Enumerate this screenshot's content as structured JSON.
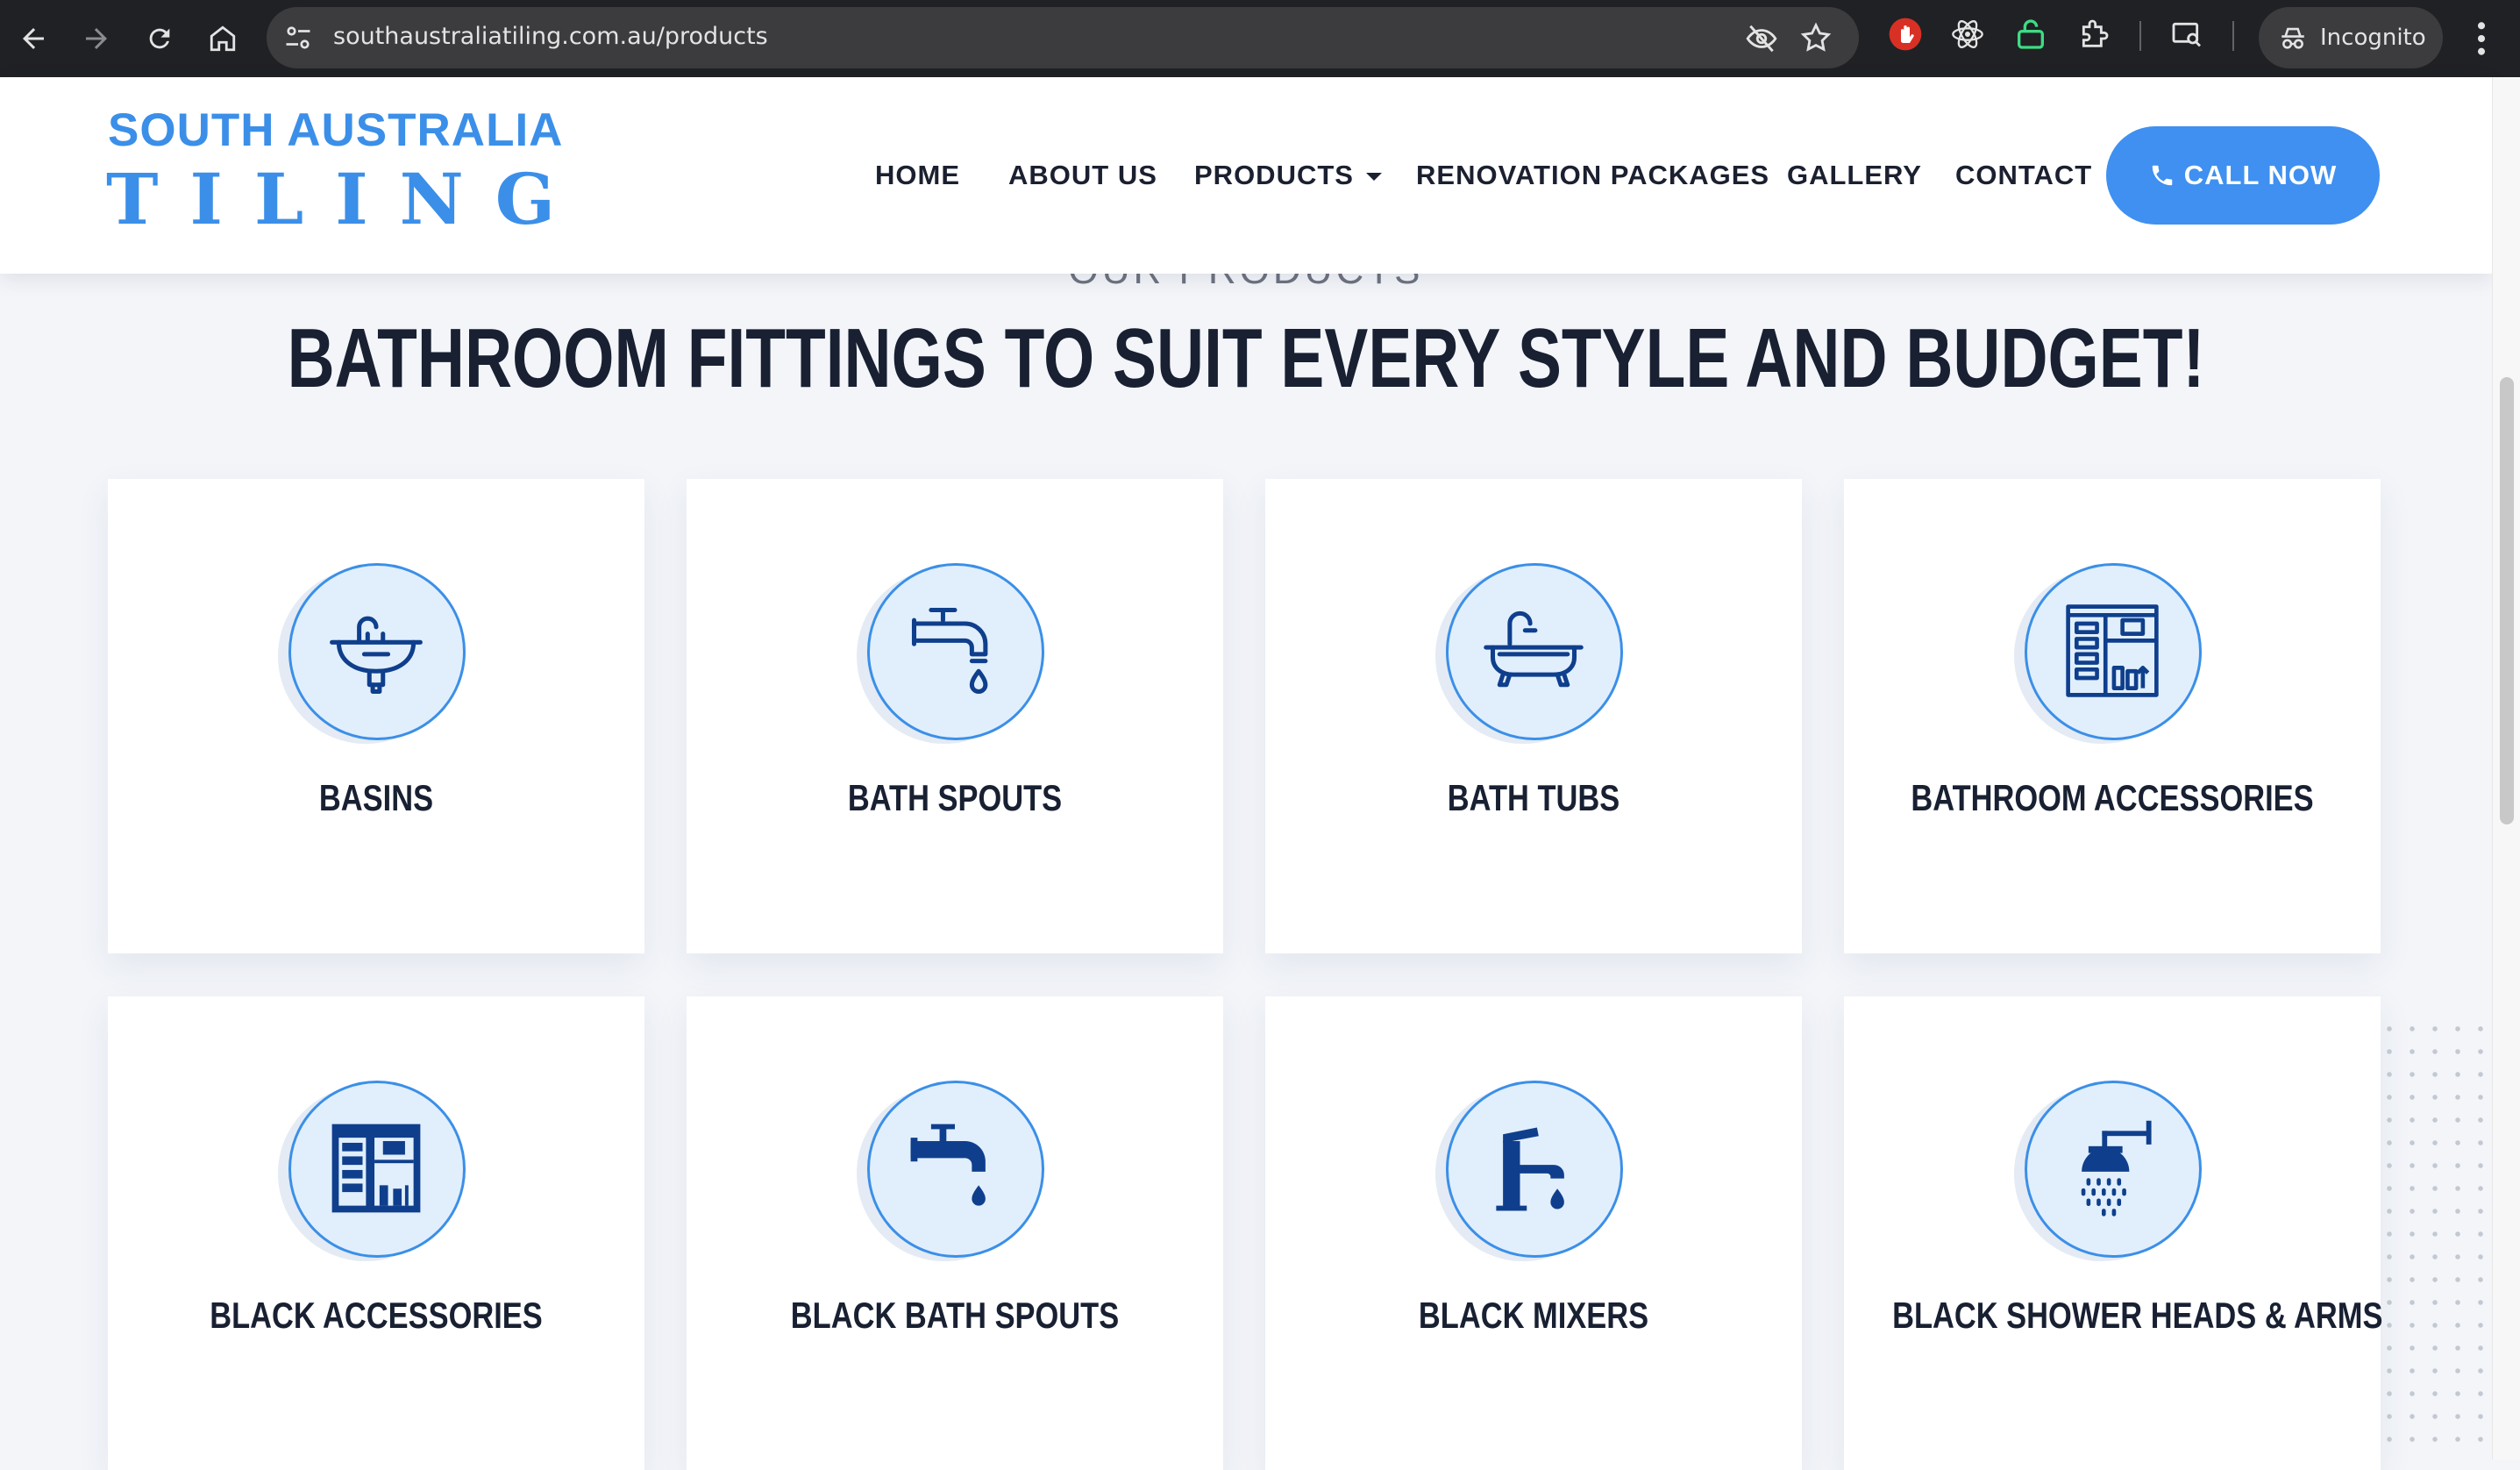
{
  "browser": {
    "url": "southaustraliatiling.com.au/products",
    "incognito_label": "Incognito",
    "icons": [
      "back-icon",
      "forward-icon",
      "reload-icon",
      "home-icon",
      "site-settings-icon",
      "eye-off-icon",
      "bookmark-star-icon",
      "extension-red-hand-icon",
      "extension-atom-icon",
      "extension-lock-icon",
      "extensions-puzzle-icon",
      "cast-search-icon",
      "incognito-icon",
      "more-icon"
    ]
  },
  "site": {
    "logo_line1": "SOUTH AUSTRALIA",
    "logo_line2": "TILING",
    "nav": {
      "home": "HOME",
      "about": "ABOUT US",
      "products": "PRODUCTS",
      "renovation": "RENOVATION PACKAGES",
      "gallery": "GALLERY",
      "contact": "CONTACT"
    },
    "call_button": "CALL NOW",
    "accent_color": "#3b8fe8"
  },
  "section": {
    "eyebrow": "OUR PRODUCTS",
    "heading": "BATHROOM FITTINGS TO SUIT EVERY STYLE AND BUDGET!"
  },
  "products": [
    {
      "label": "BASINS",
      "icon": "basin-icon"
    },
    {
      "label": "BATH SPOUTS",
      "icon": "bath-spout-icon"
    },
    {
      "label": "BATH TUBS",
      "icon": "bath-tub-icon"
    },
    {
      "label": "BATHROOM ACCESSORIES",
      "icon": "bathroom-cabinet-icon"
    },
    {
      "label": "BLACK ACCESSORIES",
      "icon": "black-cabinet-icon"
    },
    {
      "label": "BLACK BATH SPOUTS",
      "icon": "black-bath-spout-icon"
    },
    {
      "label": "BLACK MIXERS",
      "icon": "black-mixer-icon"
    },
    {
      "label": "BLACK SHOWER HEADS & ARMS",
      "icon": "black-shower-head-icon"
    }
  ]
}
